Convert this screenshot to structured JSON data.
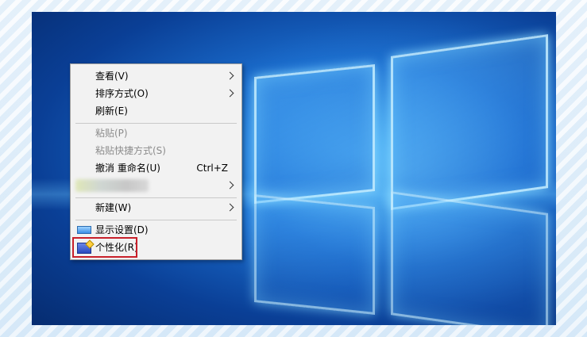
{
  "context_menu": {
    "items": [
      {
        "label": "查看(V)",
        "submenu": true
      },
      {
        "label": "排序方式(O)",
        "submenu": true
      },
      {
        "label": "刷新(E)"
      },
      {
        "label": "粘贴(P)",
        "disabled": true
      },
      {
        "label": "粘贴快捷方式(S)",
        "disabled": true
      },
      {
        "label": "撤消 重命名(U)",
        "shortcut": "Ctrl+Z"
      },
      {
        "label": "",
        "submenu": true,
        "blurred": true
      },
      {
        "label": "新建(W)",
        "submenu": true
      },
      {
        "label": "显示设置(D)",
        "icon": "display-icon"
      },
      {
        "label": "个性化(R)",
        "icon": "personalize-icon",
        "highlighted": true
      }
    ]
  },
  "colors": {
    "menu_bg": "#f2f2f2",
    "highlight_border": "#c8202a",
    "disabled_text": "#8c8c8c",
    "desktop_blue": "#1b6fd0"
  }
}
